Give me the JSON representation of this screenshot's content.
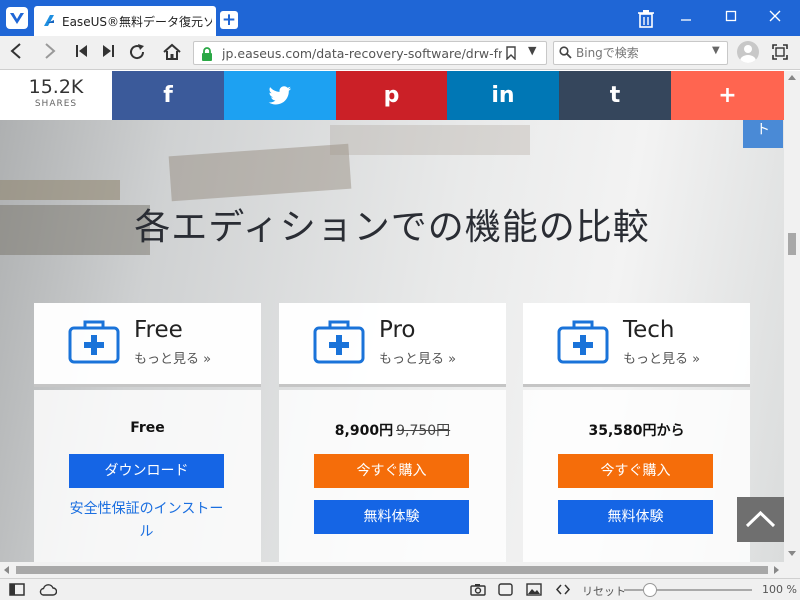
{
  "browser": {
    "tab_title": "EaseUS®無料データ復元ソフト",
    "url": "jp.easeus.com/data-recovery-software/drw-fr...",
    "search_placeholder": "Bingで検索",
    "zoom_reset_label": "リセット",
    "zoom_level": "100 %"
  },
  "share_bar": {
    "count": "15.2K",
    "count_label": "SHARES",
    "buttons": [
      {
        "glyph": "f",
        "color": "#3b5a9a"
      },
      {
        "glyph": "t",
        "color": "#1da1f2"
      },
      {
        "glyph": "p",
        "color": "#cb2027"
      },
      {
        "glyph": "in",
        "color": "#0077b5"
      },
      {
        "glyph": "t",
        "color": "#35465c"
      },
      {
        "glyph": "+",
        "color": "#ff6550"
      }
    ]
  },
  "side_tab_label": "ト",
  "heading": "各エディションでの機能の比較",
  "editions": [
    {
      "name": "Free",
      "more": "もっと見る »",
      "price": "Free",
      "old_price": "",
      "primary_button": "ダウンロード",
      "link": "安全性保証のインストール"
    },
    {
      "name": "Pro",
      "more": "もっと見る »",
      "price": "8,900円",
      "old_price": "9,750円",
      "primary_button": "今すぐ購入",
      "secondary_button": "無料体験"
    },
    {
      "name": "Tech",
      "more": "もっと見る »",
      "price": "35,580円から",
      "old_price": "",
      "primary_button": "今すぐ購入",
      "secondary_button": "無料体験"
    }
  ],
  "colors": {
    "titlebar": "#1f66d6",
    "primary_blue": "#1565e5",
    "buy_orange": "#f56d0a",
    "icon_blue": "#1a73d9"
  }
}
